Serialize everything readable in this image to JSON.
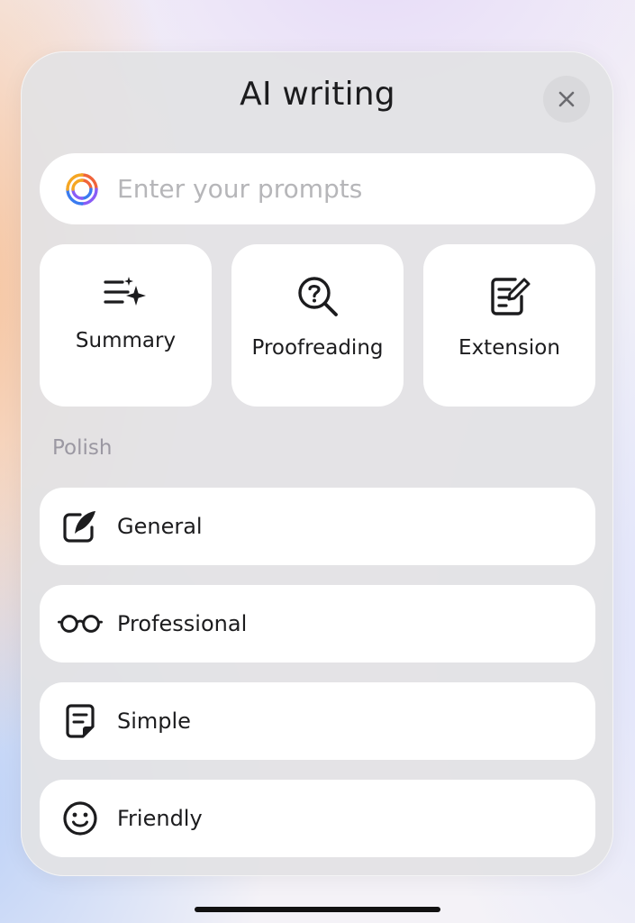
{
  "dialog": {
    "title": "AI writing",
    "close_icon": "close-icon"
  },
  "prompt": {
    "placeholder": "Enter your prompts",
    "value": "",
    "icon": "ai-swirl-logo-icon"
  },
  "tools": [
    {
      "label": "Summary",
      "icon": "summary-sparkle-icon"
    },
    {
      "label": "Proofreading",
      "icon": "proofreading-magnifier-icon"
    },
    {
      "label": "Extension",
      "icon": "extension-edit-icon"
    }
  ],
  "polish": {
    "section_label": "Polish",
    "items": [
      {
        "label": "General",
        "icon": "feather-pen-icon"
      },
      {
        "label": "Professional",
        "icon": "glasses-icon"
      },
      {
        "label": "Simple",
        "icon": "note-icon"
      },
      {
        "label": "Friendly",
        "icon": "smiley-icon"
      }
    ]
  },
  "colors": {
    "panel_bg": "#e2e2e4",
    "card_bg": "#ffffff",
    "text_primary": "#1c1c1e",
    "placeholder_text": "#b6b6b9",
    "section_label": "#9b98a2"
  }
}
